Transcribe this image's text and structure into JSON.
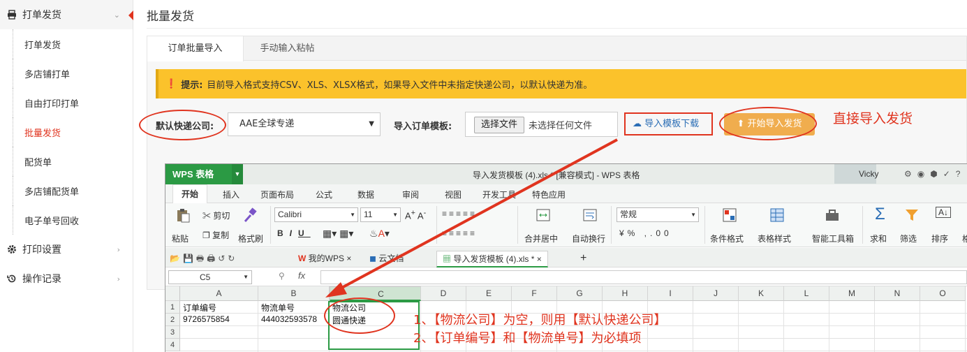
{
  "sidebar": {
    "groups": [
      {
        "label": "打单发货",
        "items": [
          "打单发货",
          "多店铺打单",
          "自由打印打单",
          "批量发货",
          "配货单",
          "多店铺配货单",
          "电子单号回收"
        ],
        "active": "批量发货"
      },
      {
        "label": "打印设置"
      },
      {
        "label": "操作记录"
      }
    ]
  },
  "page": {
    "title": "批量发货",
    "tabs": [
      "订单批量导入",
      "手动输入粘帖"
    ],
    "tip_label": "提示:",
    "tip_text": "目前导入格式支持CSV、XLS、XLSX格式，如果导入文件中未指定快递公司，以默认快递为准。",
    "courier_label": "默认快递公司:",
    "courier_value": "AAE全球专递",
    "template_label": "导入订单模板:",
    "file_button": "选择文件",
    "file_text": "未选择任何文件",
    "download_label": "导入模板下载",
    "start_label": "开始导入发货"
  },
  "annotations": {
    "direct": "直接导入发货",
    "note1": "1、【物流公司】为空，则用【默认快递公司】",
    "note2": "2、【订单编号】和【物流单号】为必填项"
  },
  "wps": {
    "app": "WPS 表格",
    "title": "导入发货模板 (4).xls * [兼容模式] - WPS 表格",
    "user": "Vicky",
    "menus": [
      "开始",
      "插入",
      "页面布局",
      "公式",
      "数据",
      "审阅",
      "视图",
      "开发工具",
      "特色应用"
    ],
    "ribbon": {
      "paste": "粘贴",
      "cut": "剪切",
      "copy": "复制",
      "format_painter": "格式刷",
      "font": "Calibri",
      "size": "11",
      "merge": "合并居中",
      "wrap": "自动换行",
      "numfmt": "常规",
      "cond_fmt": "条件格式",
      "table_style": "表格样式",
      "toolbox": "智能工具箱",
      "sum": "求和",
      "filter": "筛选",
      "sort": "排序",
      "more": "格"
    },
    "doc_tabs": [
      "我的WPS",
      "云文档",
      "导入发货模板 (4).xls *"
    ],
    "namebox": "C5",
    "fx": "fx",
    "columns": [
      "A",
      "B",
      "C",
      "D",
      "E",
      "F",
      "G",
      "H",
      "I",
      "J",
      "K",
      "L",
      "M",
      "N",
      "O"
    ],
    "rows": [
      "1",
      "2",
      "3",
      "4"
    ],
    "cells": {
      "A1": "订单编号",
      "B1": "物流单号",
      "C1": "物流公司",
      "A2": "9726575854",
      "B2": "444032593578",
      "C2": "圆通快递"
    }
  },
  "colors": {
    "accent_red": "#e0341f",
    "wps_green": "#2b9a44",
    "tip_yellow": "#fbc22b",
    "start_orange": "#f0ad4e"
  }
}
